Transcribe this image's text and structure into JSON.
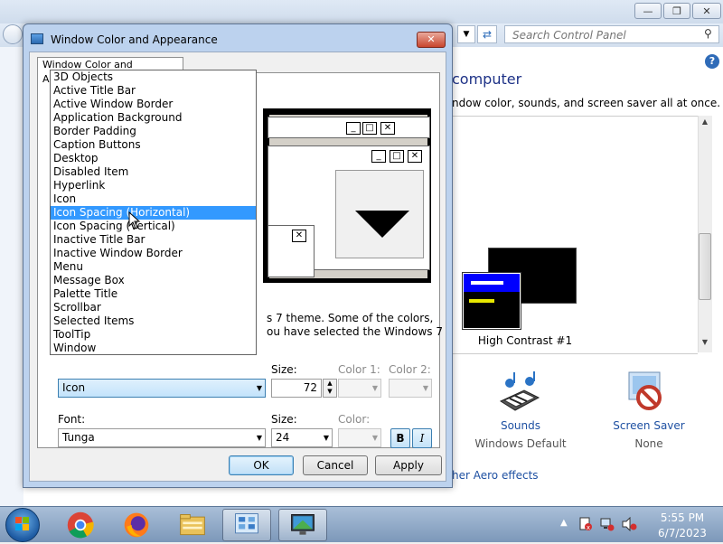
{
  "control_panel": {
    "search_placeholder": "Search Control Panel",
    "heading": "computer",
    "description": "ndow color, sounds, and screen saver all at once.",
    "theme_name": "High Contrast #1",
    "sounds_label": "Sounds",
    "sounds_value": "Windows Default",
    "screensaver_label": "Screen Saver",
    "screensaver_value": "None",
    "aero_link": "her Aero effects",
    "help_glyph": "?"
  },
  "dialog": {
    "title": "Window Color and Appearance",
    "tab_label": "Window Color and Appearance",
    "info_line1": "s 7 theme.  Some of the colors,",
    "info_line2": "ou have selected the Windows 7",
    "item_value": "Icon",
    "size_label": "Size:",
    "size_value": "72",
    "color1_label": "Color 1:",
    "color2_label": "Color 2:",
    "font_label": "Font:",
    "font_value": "Tunga",
    "font_size_label": "Size:",
    "font_size_value": "24",
    "font_color_label": "Color:",
    "bold_label": "B",
    "italic_label": "I",
    "ok_label": "OK",
    "cancel_label": "Cancel",
    "apply_label": "Apply",
    "dropdown_items": [
      "3D Objects",
      "Active Title Bar",
      "Active Window Border",
      "Application Background",
      "Border Padding",
      "Caption Buttons",
      "Desktop",
      "Disabled Item",
      "Hyperlink",
      "Icon",
      "Icon Spacing (Horizontal)",
      "Icon Spacing (Vertical)",
      "Inactive Title Bar",
      "Inactive Window Border",
      "Menu",
      "Message Box",
      "Palette Title",
      "Scrollbar",
      "Selected Items",
      "ToolTip",
      "Window"
    ],
    "selected_index": 10
  },
  "taskbar": {
    "time": "5:55 PM",
    "date": "6/7/2023",
    "apps": [
      "chrome-icon",
      "firefox-icon",
      "explorer-icon",
      "control-panel-icon",
      "display-settings-icon"
    ]
  },
  "colors": {
    "selection": "#3399ff",
    "link": "#1e50a2",
    "high_contrast_title": "#0000ff"
  }
}
